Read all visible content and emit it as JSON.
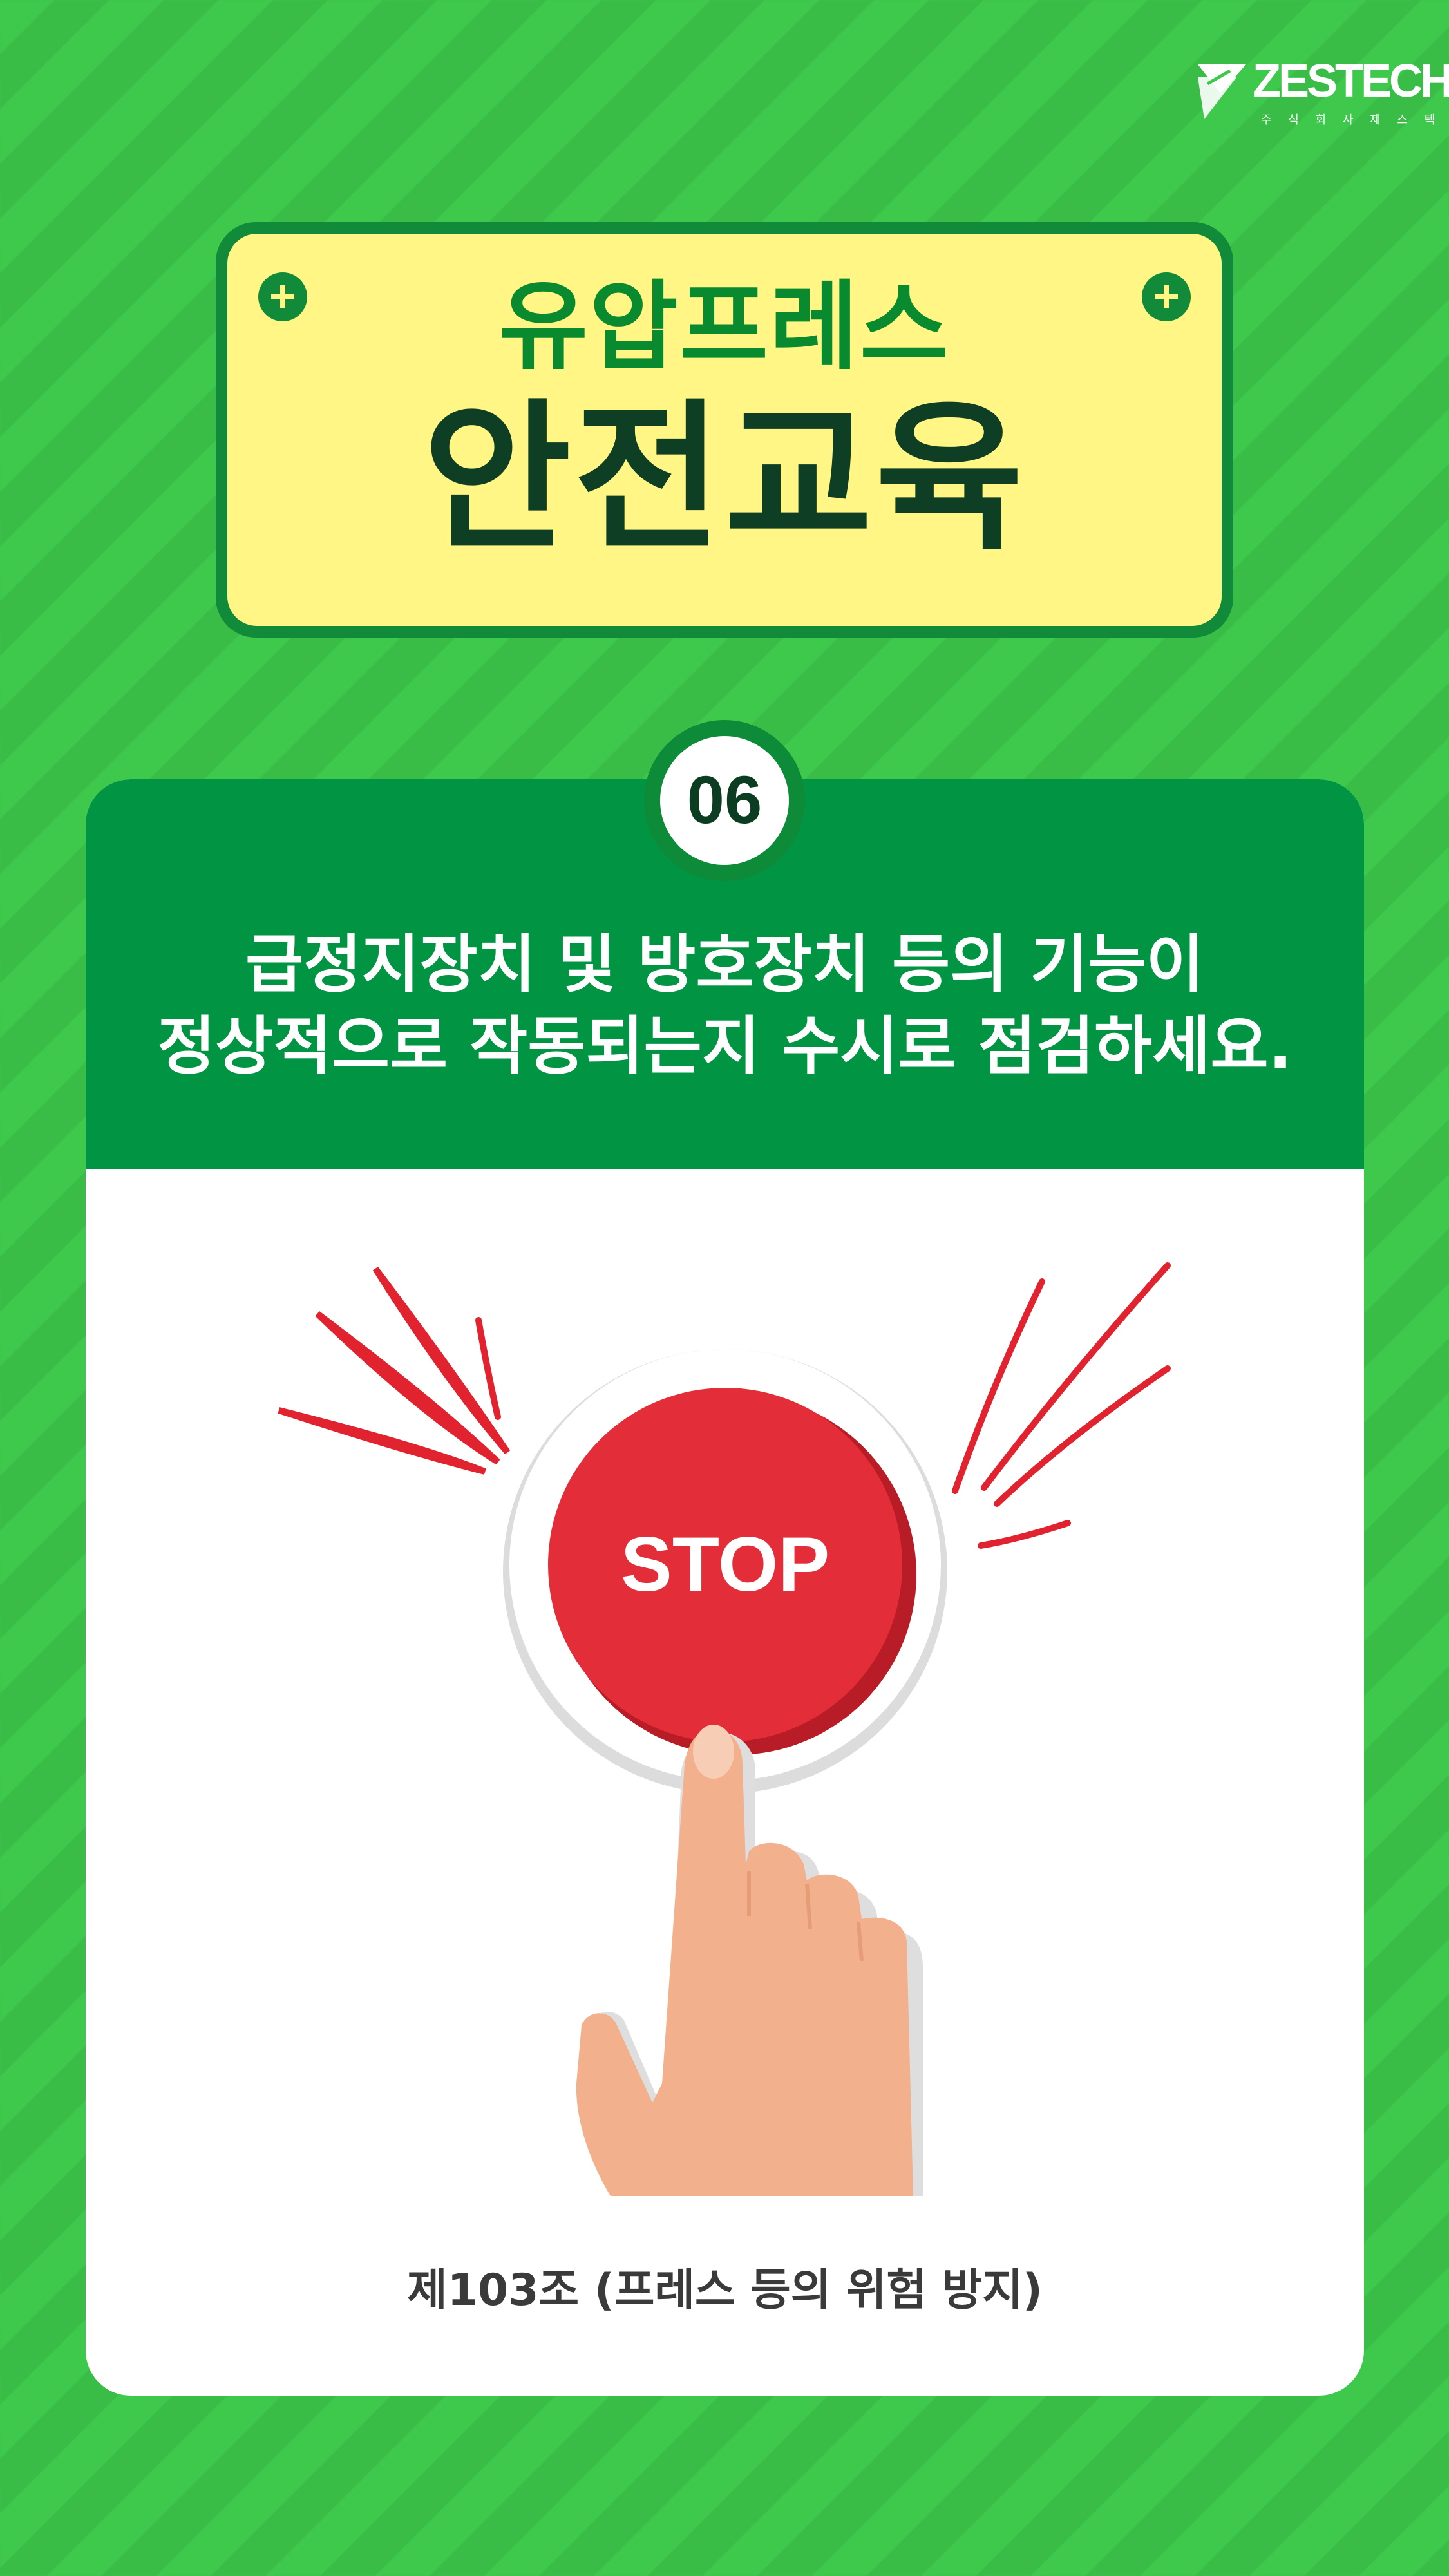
{
  "brand": {
    "name": "ZESTECH",
    "subtitle": "주 식 회 사 제 스 텍"
  },
  "title": {
    "line1": "유압프레스",
    "line2": "안전교육"
  },
  "card": {
    "number": "06",
    "headline_line1": "급정지장치 및 방호장치 등의 기능이",
    "headline_line2": "정상적으로 작동되는지 수시로 점검하세요.",
    "button_label": "STOP",
    "caption": "제103조 (프레스 등의 위험 방지)"
  },
  "colors": {
    "background": "#3ec84c",
    "dark_green": "#009443",
    "title_board": "#fff685",
    "stop_red": "#e32d38",
    "skin": "#f3b08d"
  },
  "icons": [
    "zestech-leaf-logo-icon",
    "plus-icon",
    "stop-button-icon",
    "pointing-hand-icon",
    "alert-burst-lines-icon"
  ]
}
